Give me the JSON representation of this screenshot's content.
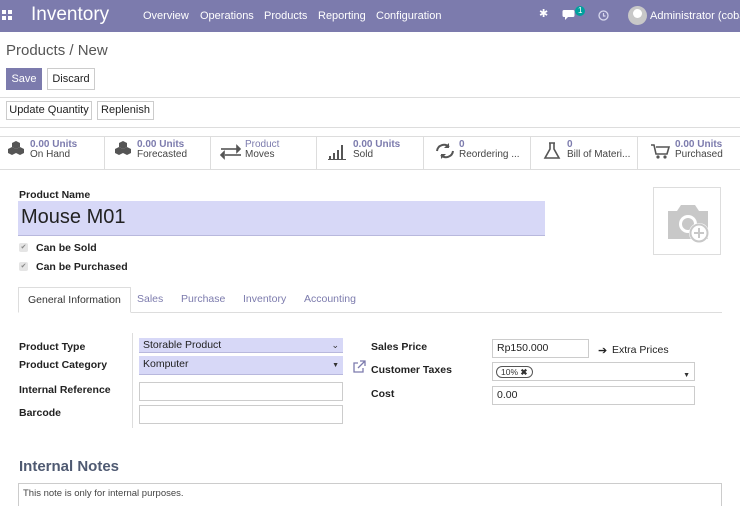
{
  "nav": {
    "app_title": "Inventory",
    "menu": [
      "Overview",
      "Operations",
      "Products",
      "Reporting",
      "Configuration"
    ],
    "message_count": "1",
    "user": "Administrator (cobak"
  },
  "breadcrumb": "Products / New",
  "actions": {
    "save": "Save",
    "discard": "Discard",
    "update_quantity": "Update Quantity",
    "replenish": "Replenish"
  },
  "stats": [
    {
      "value": "0.00 Units",
      "label": "On Hand",
      "icon": "cubes-icon"
    },
    {
      "value": "0.00 Units",
      "label": "Forecasted",
      "icon": "cubes-icon"
    },
    {
      "value": "",
      "label": "Product Moves",
      "line1": "Product",
      "line2": "Moves",
      "icon": "exchange-icon"
    },
    {
      "value": "0.00 Units",
      "label": "Sold",
      "icon": "bar-chart-icon"
    },
    {
      "value": "0",
      "label": "Reordering ...",
      "icon": "refresh-icon"
    },
    {
      "value": "0",
      "label": "Bill of Materi...",
      "icon": "flask-icon"
    },
    {
      "value": "0.00 Units",
      "label": "Purchased",
      "icon": "cart-icon"
    }
  ],
  "form": {
    "product_name_label": "Product Name",
    "product_name": "Mouse M01",
    "can_be_sold": "Can be Sold",
    "can_be_purchased": "Can be Purchased",
    "tabs": [
      "General Information",
      "Sales",
      "Purchase",
      "Inventory",
      "Accounting"
    ],
    "product_type_label": "Product Type",
    "product_type": "Storable Product",
    "product_category_label": "Product Category",
    "product_category": "Komputer",
    "internal_reference_label": "Internal Reference",
    "internal_reference": "",
    "barcode_label": "Barcode",
    "barcode": "",
    "sales_price_label": "Sales Price",
    "sales_price": "Rp150.000",
    "extra_prices": "Extra Prices",
    "customer_taxes_label": "Customer Taxes",
    "customer_tax_tag": "10%",
    "cost_label": "Cost",
    "cost": "0.00"
  },
  "notes": {
    "title": "Internal Notes",
    "placeholder": "This note is only for internal purposes."
  },
  "colors": {
    "brand": "#7c7bad",
    "required_field": "#d7d8f7"
  }
}
